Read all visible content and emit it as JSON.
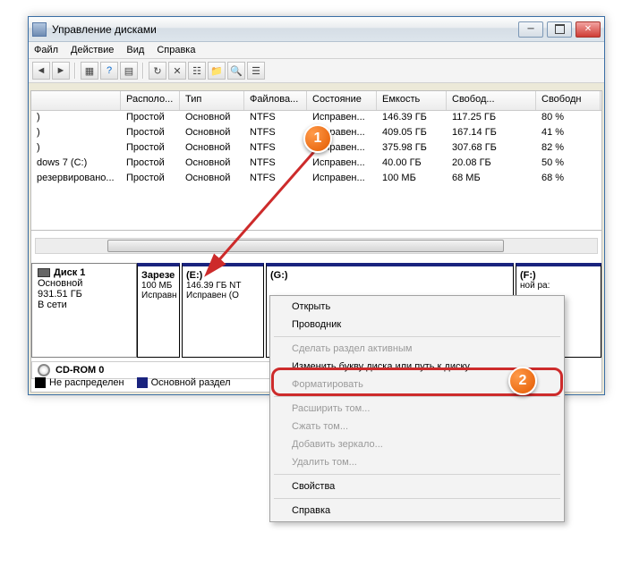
{
  "window": {
    "title": "Управление дисками"
  },
  "menubar": {
    "file": "Файл",
    "action": "Действие",
    "view": "Вид",
    "help": "Справка"
  },
  "list": {
    "headers": [
      "",
      "Располо...",
      "Тип",
      "Файлова...",
      "Состояние",
      "Емкость",
      "Свобод...",
      "Свободн"
    ],
    "rows": [
      [
        ")",
        "Простой",
        "Основной",
        "NTFS",
        "Исправен...",
        "146.39 ГБ",
        "117.25 ГБ",
        "80 %"
      ],
      [
        ")",
        "Простой",
        "Основной",
        "NTFS",
        "Исправен...",
        "409.05 ГБ",
        "167.14 ГБ",
        "41 %"
      ],
      [
        ")",
        "Простой",
        "Основной",
        "NTFS",
        "Исправен...",
        "375.98 ГБ",
        "307.68 ГБ",
        "82 %"
      ],
      [
        "dows 7 (C:)",
        "Простой",
        "Основной",
        "NTFS",
        "Исправен...",
        "40.00 ГБ",
        "20.08 ГБ",
        "50 %"
      ],
      [
        "резервировано...",
        "Простой",
        "Основной",
        "NTFS",
        "Исправен...",
        "100 МБ",
        "68 МБ",
        "68 %"
      ]
    ]
  },
  "disk1": {
    "name": "Диск 1",
    "type": "Основной",
    "size": "931.51 ГБ",
    "status": "В сети",
    "parts": [
      {
        "label": "Зарезе",
        "size": "100 МБ",
        "stat": "Исправн"
      },
      {
        "label": "(E:)",
        "size": "146.39 ГБ NT",
        "stat": "Исправен (О"
      },
      {
        "label": "(G:)",
        "size": "",
        "stat": ""
      },
      {
        "label": "(F:)",
        "size": "",
        "stat": "ной ра:"
      }
    ]
  },
  "cdrom": {
    "name": "CD-ROM 0"
  },
  "legend": {
    "l1": "Не распределен",
    "l2": "Основной раздел"
  },
  "ctx": {
    "open": "Открыть",
    "explorer": "Проводник",
    "active": "Сделать раздел активным",
    "change": "Изменить букву диска или путь к диску...",
    "format": "Форматировать",
    "extend": "Расширить том...",
    "shrink": "Сжать том...",
    "mirror": "Добавить зеркало...",
    "delete": "Удалить том...",
    "props": "Свойства",
    "help": "Справка"
  },
  "callout": {
    "one": "1",
    "two": "2"
  }
}
